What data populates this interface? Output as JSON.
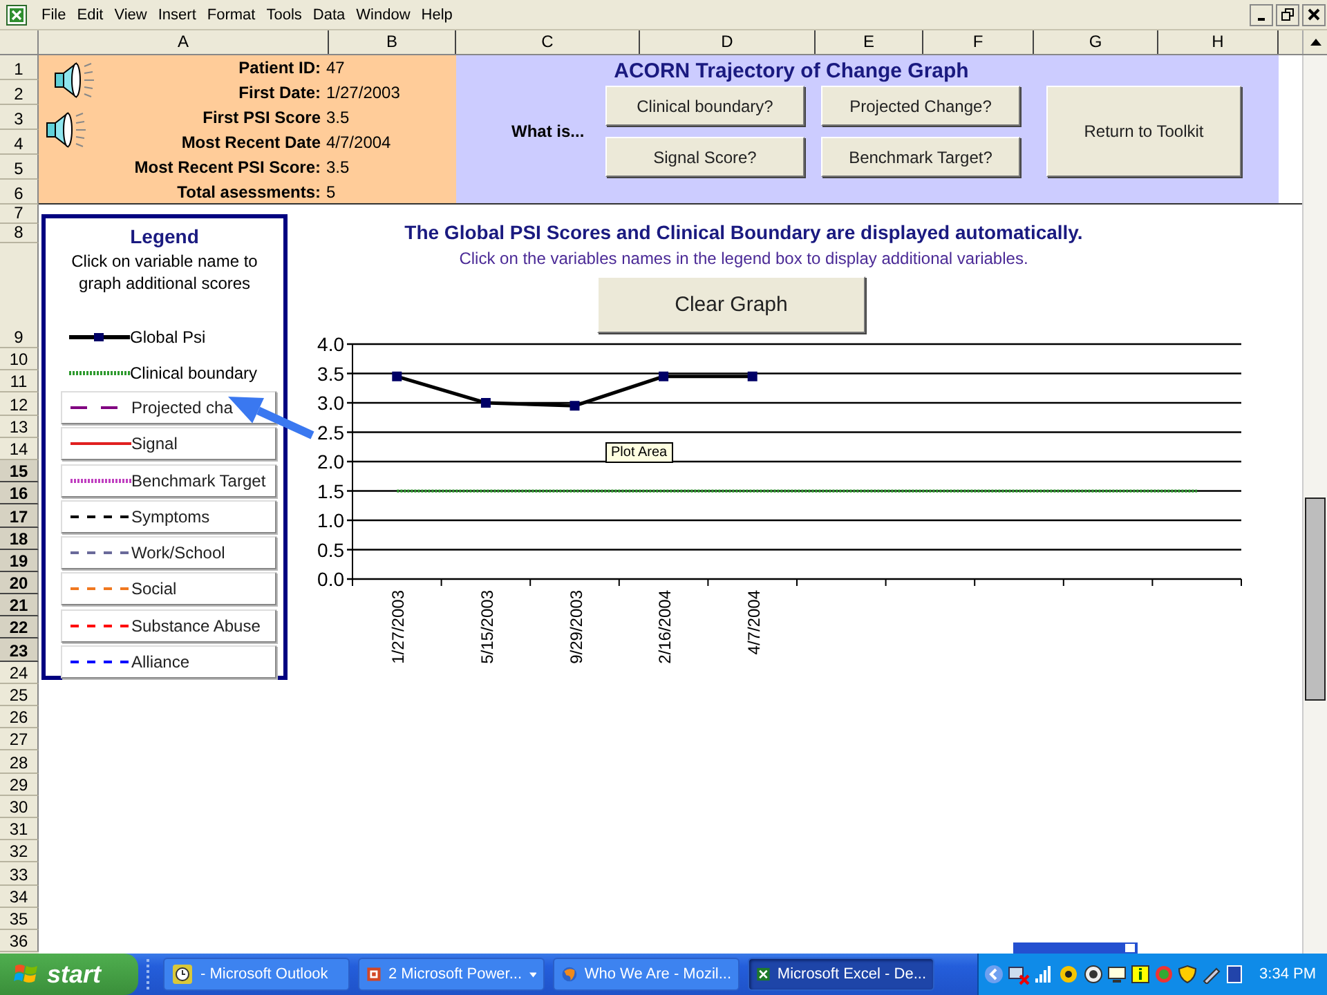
{
  "menu": [
    "File",
    "Edit",
    "View",
    "Insert",
    "Format",
    "Tools",
    "Data",
    "Window",
    "Help"
  ],
  "columns": [
    "A",
    "B",
    "C",
    "D",
    "E",
    "F",
    "G",
    "H"
  ],
  "rows": [
    {
      "label": "1",
      "selected": false
    },
    {
      "label": "2",
      "selected": false
    },
    {
      "label": "3",
      "selected": false
    },
    {
      "label": "4",
      "selected": false
    },
    {
      "label": "5",
      "selected": false
    },
    {
      "label": "6",
      "selected": false
    },
    {
      "label": "7",
      "selected": false
    },
    {
      "label": "8",
      "selected": false
    },
    {
      "label": "9",
      "selected": false
    },
    {
      "label": "10",
      "selected": false
    },
    {
      "label": "11",
      "selected": false
    },
    {
      "label": "12",
      "selected": false
    },
    {
      "label": "13",
      "selected": false
    },
    {
      "label": "14",
      "selected": false
    },
    {
      "label": "15",
      "selected": true
    },
    {
      "label": "16",
      "selected": true
    },
    {
      "label": "17",
      "selected": true
    },
    {
      "label": "18",
      "selected": true
    },
    {
      "label": "19",
      "selected": true
    },
    {
      "label": "20",
      "selected": true
    },
    {
      "label": "21",
      "selected": true
    },
    {
      "label": "22",
      "selected": true
    },
    {
      "label": "23",
      "selected": true
    },
    {
      "label": "24",
      "selected": false
    },
    {
      "label": "25",
      "selected": false
    },
    {
      "label": "26",
      "selected": false
    },
    {
      "label": "27",
      "selected": false
    },
    {
      "label": "28",
      "selected": false
    },
    {
      "label": "29",
      "selected": false
    },
    {
      "label": "30",
      "selected": false
    },
    {
      "label": "31",
      "selected": false
    },
    {
      "label": "32",
      "selected": false
    },
    {
      "label": "33",
      "selected": false
    },
    {
      "label": "34",
      "selected": false
    },
    {
      "label": "35",
      "selected": false
    },
    {
      "label": "36",
      "selected": false
    }
  ],
  "patient_info": [
    {
      "label": "Patient ID:",
      "value": "47"
    },
    {
      "label": "First Date:",
      "value": "1/27/2003"
    },
    {
      "label": "First PSI Score",
      "value": "3.5"
    },
    {
      "label": "Most Recent Date",
      "value": "4/7/2004"
    },
    {
      "label": "Most Recent PSI Score:",
      "value": "3.5"
    },
    {
      "label": "Total asessments:",
      "value": "5"
    }
  ],
  "graph_panel": {
    "title": "ACORN Trajectory of Change Graph",
    "what_is": "What is...",
    "help_buttons": [
      "Clinical boundary?",
      "Projected Change?",
      "Signal Score?",
      "Benchmark Target?"
    ],
    "return_button": "Return to Toolkit"
  },
  "legend": {
    "title": "Legend",
    "hint": "Click on variable name to graph additional scores",
    "buttons": [
      {
        "label": "Projected cha",
        "kind": "long-dash",
        "color": "#800080"
      },
      {
        "label": "Signal",
        "kind": "solid",
        "color": "#e02020"
      },
      {
        "label": "Benchmark Target",
        "kind": "dotted",
        "color": "#c040c0"
      },
      {
        "label": "Symptoms",
        "kind": "dashed",
        "color": "#000000"
      },
      {
        "label": "Work/School",
        "kind": "dashed",
        "color": "#6a6a9a"
      },
      {
        "label": "Social",
        "kind": "dashed",
        "color": "#f07820"
      },
      {
        "label": "Substance Abuse",
        "kind": "dashed",
        "color": "#ff0000"
      },
      {
        "label": "Alliance",
        "kind": "dashed",
        "color": "#0000ff"
      }
    ]
  },
  "chart": {
    "headline": "The Global PSI Scores and Clinical Boundary are displayed automatically.",
    "subtext": "Click on the variables names in the legend box to display additional variables.",
    "clear_button": "Clear Graph",
    "tooltip": "Plot Area",
    "chart_data": {
      "type": "line",
      "categories": [
        "1/27/2003",
        "5/15/2003",
        "9/29/2003",
        "2/16/2004",
        "4/7/2004",
        null,
        null,
        null,
        null,
        null
      ],
      "ylim": [
        0,
        4
      ],
      "yticks": [
        {
          "value": 0,
          "label": "0.0"
        },
        {
          "value": 0.5,
          "label": "0.5"
        },
        {
          "value": 1,
          "label": "1.0"
        },
        {
          "value": 1.5,
          "label": "1.5"
        },
        {
          "value": 2,
          "label": "2.0"
        },
        {
          "value": 2.5,
          "label": "2.5"
        },
        {
          "value": 3,
          "label": "3.0"
        },
        {
          "value": 3.5,
          "label": "3.5"
        },
        {
          "value": 4,
          "label": "4.0"
        }
      ],
      "series": [
        {
          "name": "Global Psi",
          "color": "#000000",
          "line_style": "solid",
          "marker": true,
          "values": [
            3.45,
            3.0,
            2.95,
            3.45,
            3.45,
            null,
            null,
            null,
            null,
            null
          ]
        },
        {
          "name": "Clinical boundary",
          "color": "#2e9a2e",
          "line_style": "dotted",
          "marker": false,
          "values": [
            1.5,
            1.5,
            1.5,
            1.5,
            1.5,
            1.5,
            1.5,
            1.5,
            1.5,
            1.5
          ]
        }
      ]
    }
  },
  "taskbar": {
    "start": "start",
    "tasks": [
      {
        "label": "- Microsoft Outlook",
        "kind": "outlook",
        "grouped": false,
        "selected": false
      },
      {
        "label": "2 Microsoft Power...",
        "kind": "powerpoint",
        "grouped": true,
        "selected": false
      },
      {
        "label": "Who We Are - Mozil...",
        "kind": "browser",
        "grouped": false,
        "selected": false
      },
      {
        "label": "Microsoft Excel - De...",
        "kind": "excel",
        "grouped": false,
        "selected": true
      }
    ],
    "clock": "3:34 PM"
  }
}
